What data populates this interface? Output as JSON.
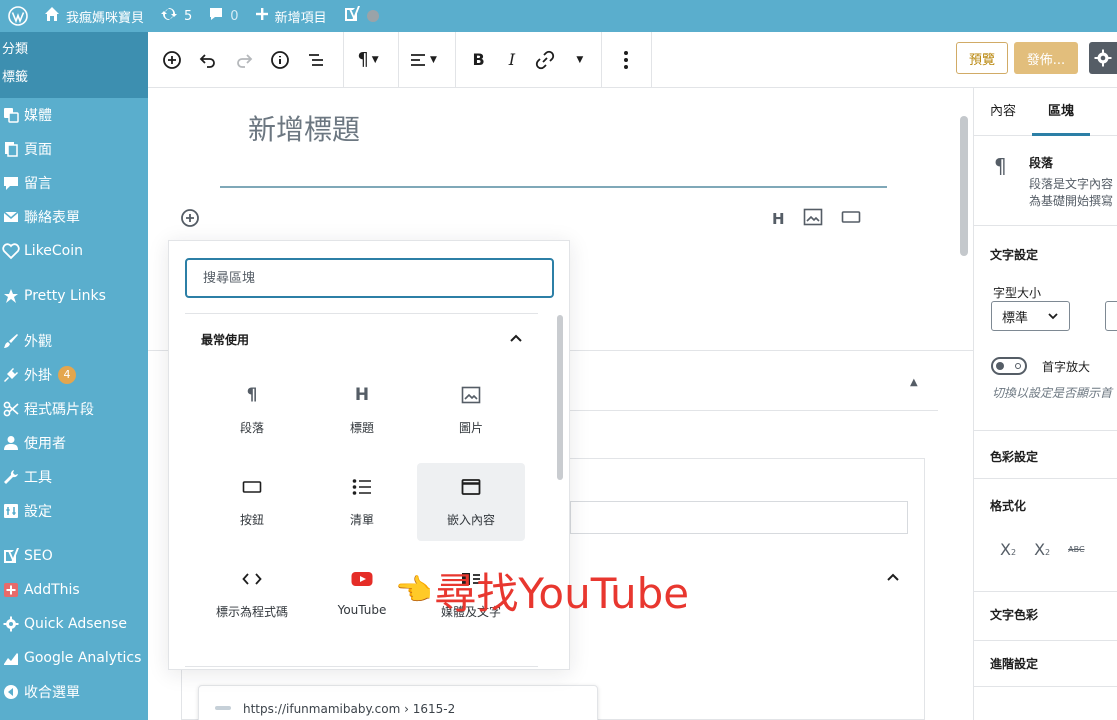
{
  "adminbar": {
    "site_name": "我瘋媽咪寶貝",
    "updates_count": "5",
    "comments_count": "0",
    "new_item": "新增項目"
  },
  "sidebar": {
    "submenu": [
      "分類",
      "標籤"
    ],
    "items": [
      {
        "label": "媒體",
        "icon": "media-icon"
      },
      {
        "label": "頁面",
        "icon": "page-icon"
      },
      {
        "label": "留言",
        "icon": "comment-icon"
      },
      {
        "label": "聯絡表單",
        "icon": "mail-icon"
      },
      {
        "label": "LikeCoin",
        "icon": "likecoin-icon"
      },
      {
        "label": "Pretty Links",
        "icon": "star-icon"
      },
      {
        "label": "外觀",
        "icon": "brush-icon"
      },
      {
        "label": "外掛",
        "icon": "plugin-icon",
        "badge": "4"
      },
      {
        "label": "程式碼片段",
        "icon": "scissors-icon"
      },
      {
        "label": "使用者",
        "icon": "user-icon"
      },
      {
        "label": "工具",
        "icon": "wrench-icon"
      },
      {
        "label": "設定",
        "icon": "settings-icon"
      },
      {
        "label": "SEO",
        "icon": "yoast-icon"
      },
      {
        "label": "AddThis",
        "icon": "plus-square-icon"
      },
      {
        "label": "Quick Adsense",
        "icon": "gear-icon"
      },
      {
        "label": "Google Analytics",
        "icon": "chart-icon"
      },
      {
        "label": "收合選單",
        "icon": "collapse-icon"
      }
    ]
  },
  "toolbar": {
    "preview_label": "預覽",
    "publish_label": "發佈..."
  },
  "editor": {
    "title_placeholder": "新增標題",
    "url_preview": "https://ifunmamibaby.com › 1615-2"
  },
  "inserter": {
    "search_placeholder": "搜尋區塊",
    "section_title": "最常使用",
    "blocks": [
      {
        "label": "段落",
        "icon": "paragraph-icon"
      },
      {
        "label": "標題",
        "icon": "heading-icon"
      },
      {
        "label": "圖片",
        "icon": "image-icon"
      },
      {
        "label": "按鈕",
        "icon": "button-icon"
      },
      {
        "label": "清單",
        "icon": "list-icon"
      },
      {
        "label": "嵌入內容",
        "icon": "embed-icon"
      },
      {
        "label": "標示為程式碼",
        "icon": "code-icon"
      },
      {
        "label": "YouTube",
        "icon": "youtube-icon"
      },
      {
        "label": "媒體及文字",
        "icon": "media-text-icon"
      }
    ]
  },
  "annotation": {
    "text": "尋找YouTube",
    "color": "#e8372f"
  },
  "settings": {
    "tabs": [
      "內容",
      "區塊"
    ],
    "block_title": "段落",
    "block_desc_1": "段落是文字內容",
    "block_desc_2": "為基礎開始撰寫",
    "text_settings": "文字設定",
    "font_size_label": "字型大小",
    "font_size_value": "標準",
    "drop_cap_label": "首字放大",
    "drop_cap_help": "切換以設定是否顯示首",
    "color_settings": "色彩設定",
    "formatting": "格式化",
    "text_color": "文字色彩",
    "advanced": "進階設定"
  },
  "colors": {
    "admin_blue": "#5aaecd",
    "accent": "#2c7fa6"
  }
}
